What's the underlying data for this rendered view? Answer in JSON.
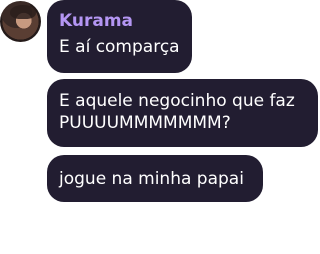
{
  "chat": {
    "sender_name": "Kurama",
    "messages": [
      {
        "text": "E aí comparça"
      },
      {
        "text": "E aquele negocinho que faz\nPUUUUMMMMMMM?"
      },
      {
        "text": "jogue na minha papai"
      }
    ]
  }
}
